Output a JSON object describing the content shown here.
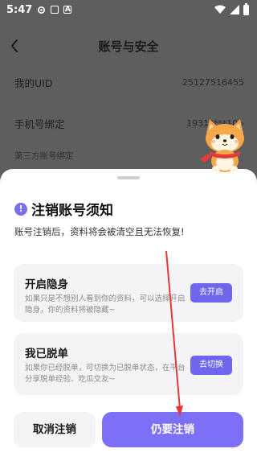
{
  "status_bar": {
    "time": "5:47",
    "icons": [
      "gear-icon",
      "sim-icon",
      "a-icon",
      "wifi-icon",
      "signal-icon",
      "battery-icon"
    ]
  },
  "header": {
    "title": "账号与安全",
    "back_icon": "chevron-left-icon"
  },
  "settings": {
    "uid_label": "我的UID",
    "uid_value": "25127516455",
    "phone_label": "手机号绑定",
    "phone_value": "1931****10 ›",
    "third_party_label": "第三方账号绑定"
  },
  "dialog": {
    "title": "注销账号须知",
    "subtitle": "账号注销后，资料将会被清空且无法恢复!",
    "options": [
      {
        "title": "开启隐身",
        "desc": "如果只是不想别人看到你的资料，可以选择开启隐身，你的资料将被隐藏~",
        "button": "去开启"
      },
      {
        "title": "我已脱单",
        "desc": "如果你已经脱单，可切换为已脱单状态，在平台分享脱单经验、吃瓜交友~",
        "button": "去切换"
      }
    ],
    "cancel_label": "取消注销",
    "confirm_label": "仍要注销"
  },
  "colors": {
    "overlay": "#5e5e5e",
    "accent": "#7d70f7",
    "card_bg": "#f4f4f6",
    "annotation_arrow": "#e53935"
  }
}
